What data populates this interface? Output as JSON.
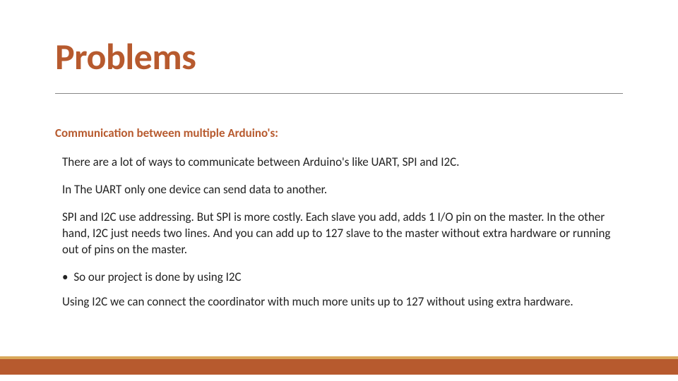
{
  "title": "Problems",
  "subhead": "Communication between multiple Arduino's:",
  "paragraphs": {
    "p1": "There are a lot of ways to communicate between Arduino's like UART, SPI and I2C.",
    "p2": "In The UART only one device can send data to another.",
    "p3": "SPI and I2C use addressing. But SPI is more costly. Each slave you add, adds 1 I/O pin on the master. In the other hand, I2C just needs two lines. And you can add up to 127 slave to the master without extra hardware or running out of pins on the master."
  },
  "bullet": "So our project is done by using I2C",
  "closing": "Using I2C we can connect the coordinator with much more units up to 127 without using extra hardware."
}
